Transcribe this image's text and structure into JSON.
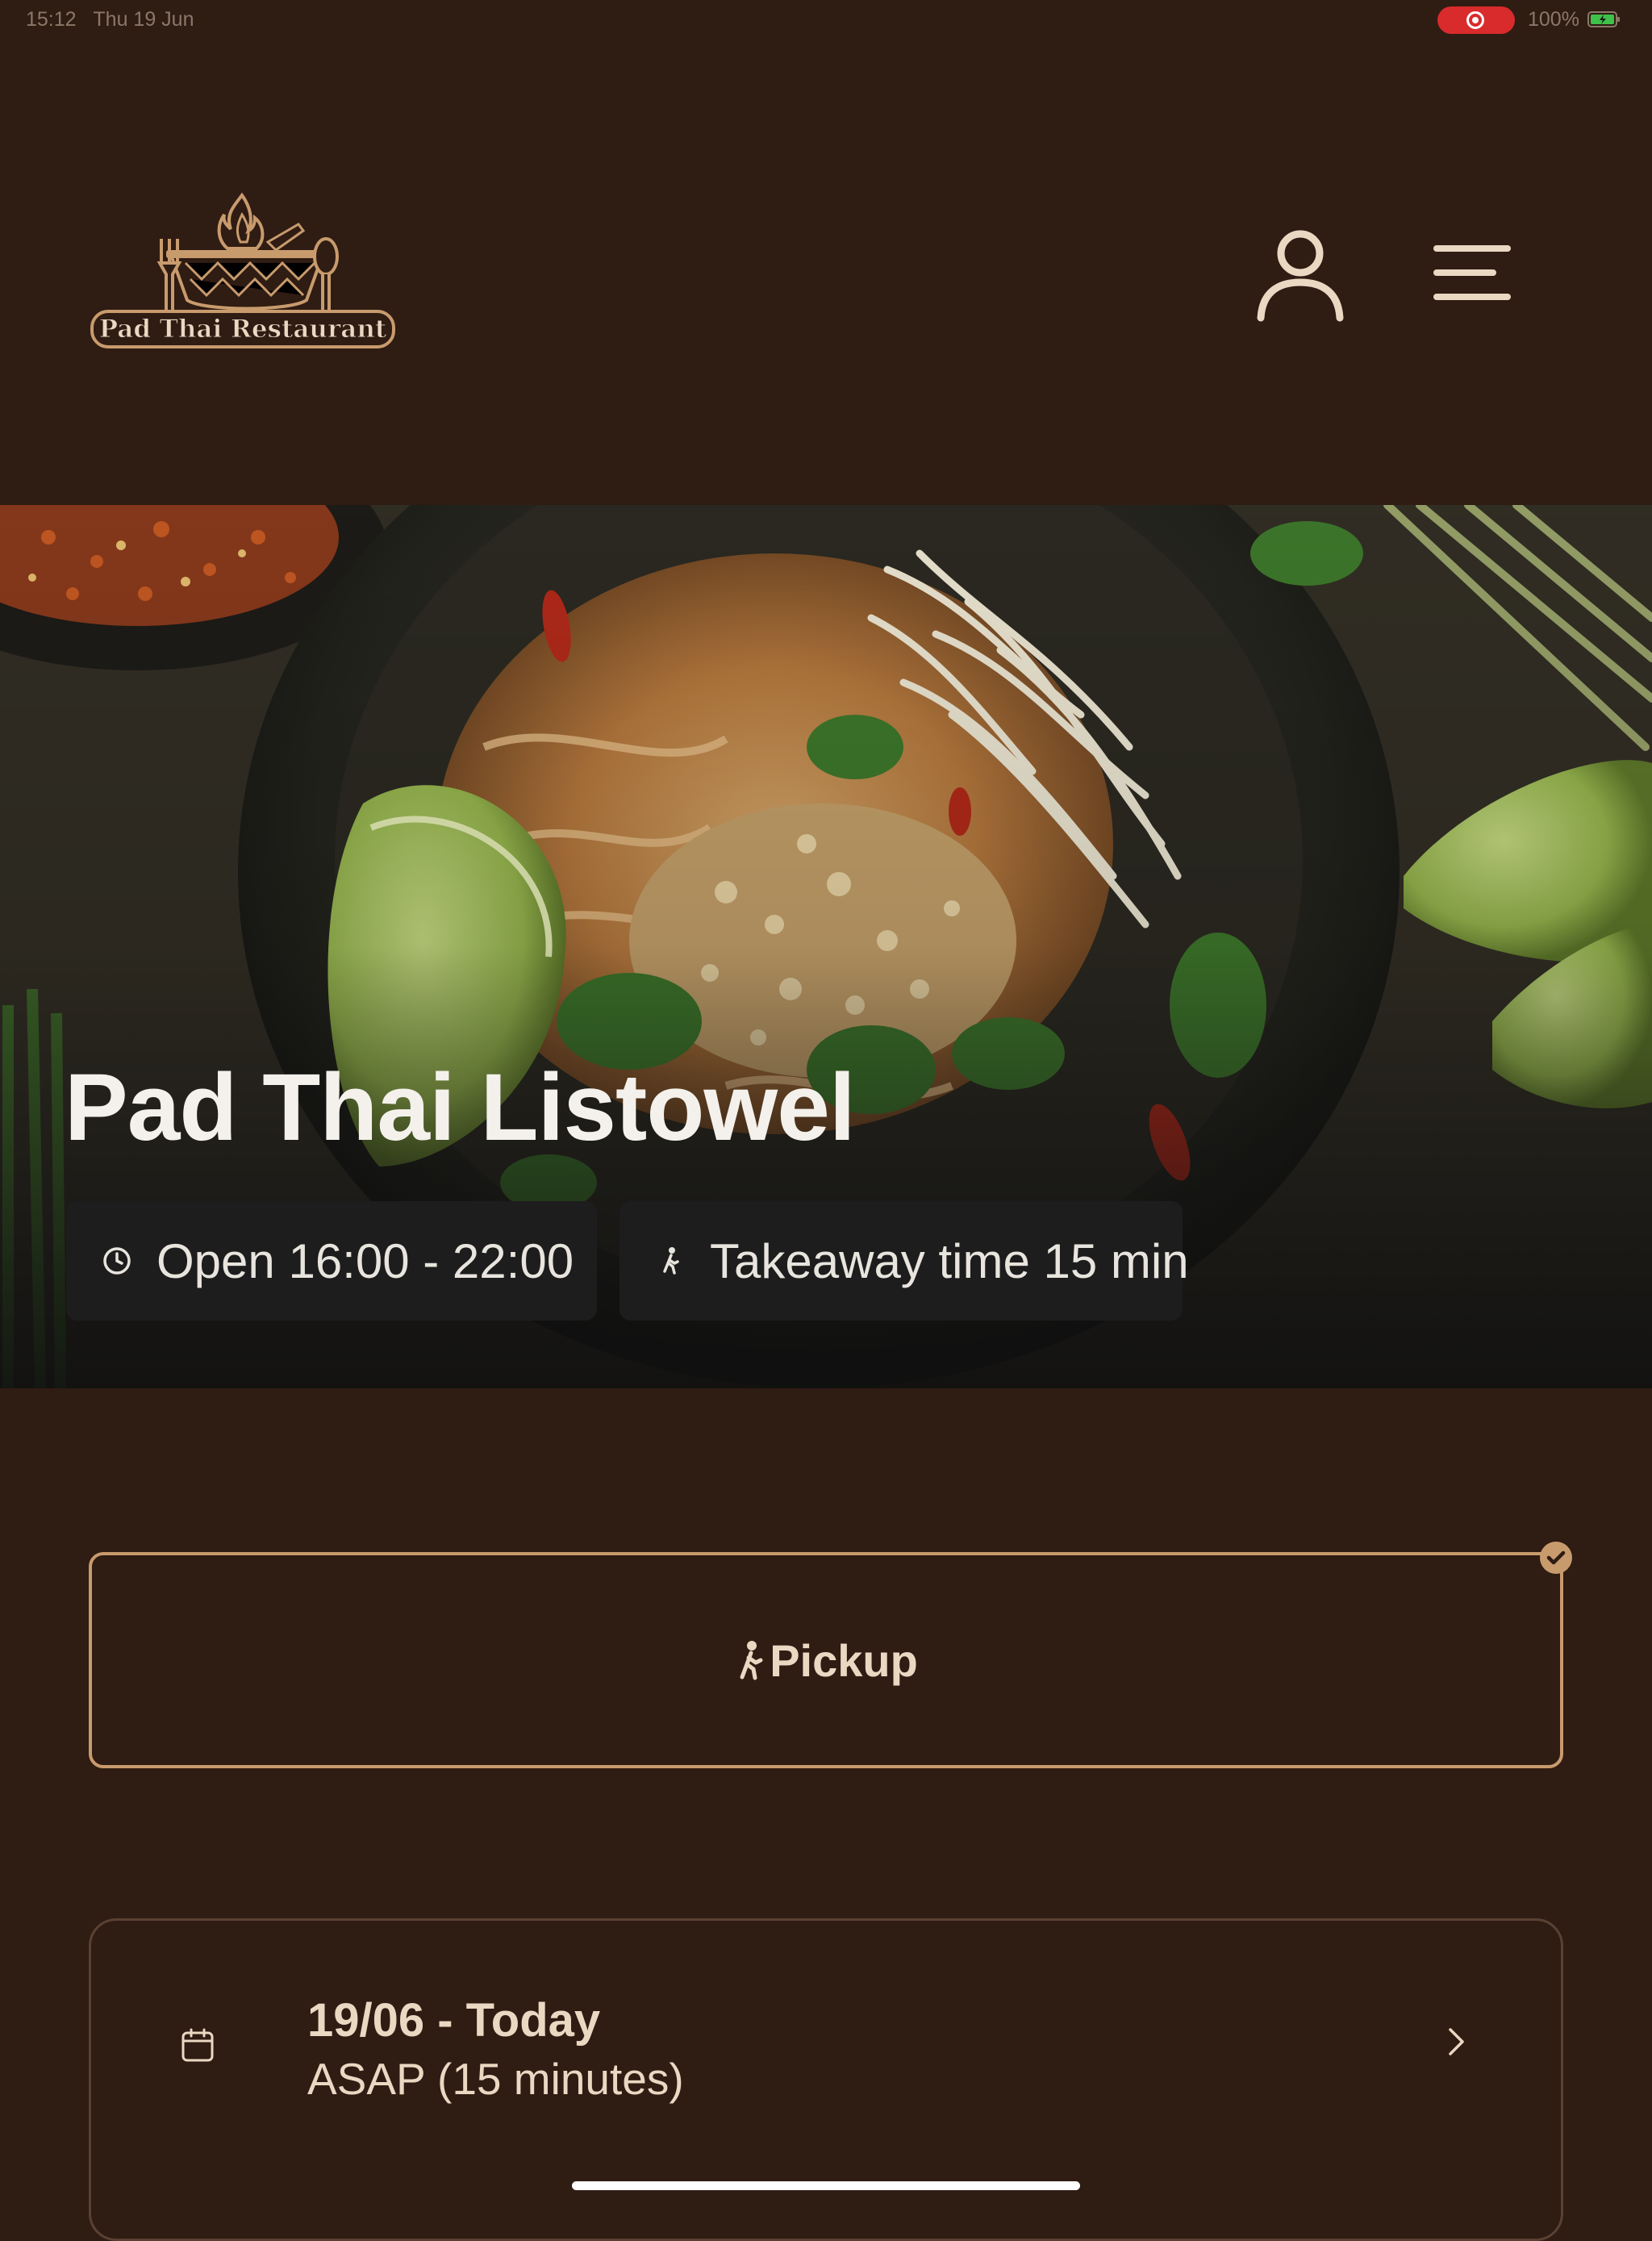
{
  "status_bar": {
    "time": "15:12",
    "date": "Thu 19 Jun",
    "battery": "100%"
  },
  "header": {
    "logo_text": "Pad Thai Restaurant",
    "account_icon": "user-icon",
    "menu_icon": "hamburger-menu-icon"
  },
  "hero": {
    "title": "Pad Thai Listowel",
    "hours": "Open 16:00 - 22:00",
    "takeaway": "Takeaway time 15 min"
  },
  "order_type": {
    "label": "Pickup",
    "selected": true
  },
  "schedule": {
    "date": "19/06 - Today",
    "time": "ASAP (15 minutes)"
  },
  "colors": {
    "background": "#2f1c13",
    "accent": "#c89b6d",
    "text": "#ead8c3",
    "chip": "#1d1d1d"
  }
}
